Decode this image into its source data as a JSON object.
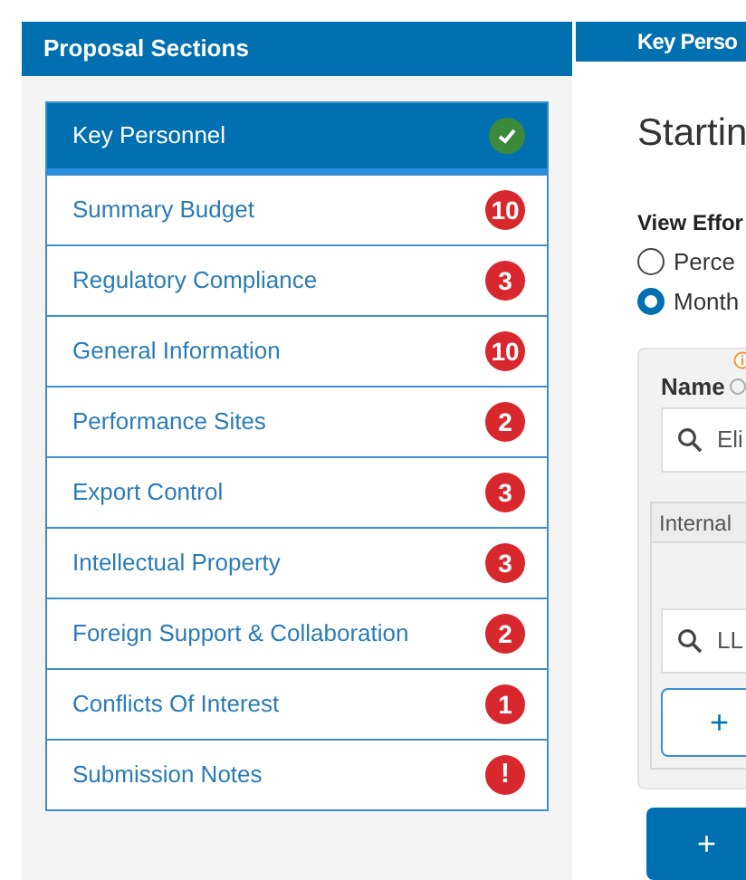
{
  "sidebar": {
    "title": "Proposal Sections",
    "items": [
      {
        "label": "Key Personnel",
        "selected": true,
        "status": {
          "kind": "check"
        }
      },
      {
        "label": "Summary Budget",
        "selected": false,
        "status": {
          "kind": "count",
          "text": "10"
        }
      },
      {
        "label": "Regulatory Compliance",
        "selected": false,
        "status": {
          "kind": "count",
          "text": "3"
        }
      },
      {
        "label": "General Information",
        "selected": false,
        "status": {
          "kind": "count",
          "text": "10"
        }
      },
      {
        "label": "Performance Sites",
        "selected": false,
        "status": {
          "kind": "count",
          "text": "2"
        }
      },
      {
        "label": "Export Control",
        "selected": false,
        "status": {
          "kind": "count",
          "text": "3"
        }
      },
      {
        "label": "Intellectual Property",
        "selected": false,
        "status": {
          "kind": "count",
          "text": "3"
        }
      },
      {
        "label": "Foreign Support & Collaboration",
        "selected": false,
        "status": {
          "kind": "count",
          "text": "2"
        }
      },
      {
        "label": "Conflicts Of Interest",
        "selected": false,
        "status": {
          "kind": "count",
          "text": "1"
        }
      },
      {
        "label": "Submission Notes",
        "selected": false,
        "status": {
          "kind": "alert",
          "text": "!"
        }
      }
    ]
  },
  "main": {
    "title": "Key Perso",
    "heading": "Startin",
    "view_effort": {
      "label": "View Effor",
      "options": [
        {
          "label": "Perce",
          "selected": false
        },
        {
          "label": "Month",
          "selected": true
        }
      ]
    },
    "card": {
      "name_label": "Name",
      "name_value": "Eli",
      "inner": {
        "title": "Internal",
        "search_value": "LL",
        "add_button": "+"
      }
    },
    "add_button": "+"
  }
}
